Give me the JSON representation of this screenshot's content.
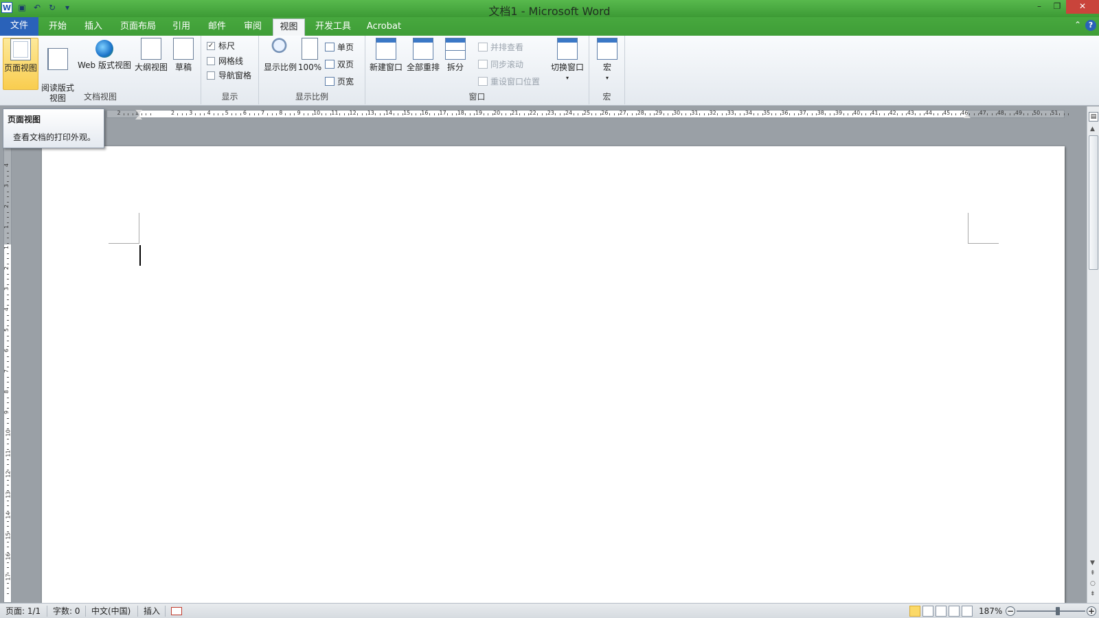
{
  "window": {
    "title": "文档1 - Microsoft Word",
    "controls": [
      "minimize-icon",
      "restore-icon",
      "close-icon"
    ]
  },
  "quick_access": [
    "word-logo-icon",
    "save-icon",
    "undo-icon",
    "redo-icon",
    "customize-icon"
  ],
  "tabs": [
    {
      "label": "文件",
      "active": false,
      "kind": "file"
    },
    {
      "label": "开始",
      "active": false
    },
    {
      "label": "插入",
      "active": false
    },
    {
      "label": "页面布局",
      "active": false
    },
    {
      "label": "引用",
      "active": false
    },
    {
      "label": "邮件",
      "active": false
    },
    {
      "label": "审阅",
      "active": false
    },
    {
      "label": "视图",
      "active": true
    },
    {
      "label": "开发工具",
      "active": false
    },
    {
      "label": "Acrobat",
      "active": false
    }
  ],
  "ribbon": {
    "doc_views": {
      "label": "文档视图",
      "buttons": [
        "页面视图",
        "阅读版式\n视图",
        "Web 版式视图",
        "大纲视图",
        "草稿"
      ],
      "selected": "页面视图"
    },
    "show": {
      "label": "显示",
      "checkboxes": [
        {
          "label": "标尺",
          "checked": true
        },
        {
          "label": "网格线",
          "checked": false
        },
        {
          "label": "导航窗格",
          "checked": false
        }
      ]
    },
    "zoom": {
      "label": "显示比例",
      "buttons": [
        "显示比例",
        "100%"
      ],
      "small": [
        "单页",
        "双页",
        "页宽"
      ]
    },
    "window": {
      "label": "窗口",
      "buttons": [
        "新建窗口",
        "全部重排",
        "拆分"
      ],
      "small_disabled": [
        "并排查看",
        "同步滚动",
        "重设窗口位置"
      ],
      "switch": "切换窗口"
    },
    "macros": {
      "label": "宏",
      "button": "宏"
    }
  },
  "tooltip": {
    "title": "页面视图",
    "description": "查看文档的打印外观。"
  },
  "ruler": {
    "h_numbers": [
      "2",
      "1",
      "1",
      "2",
      "3",
      "4",
      "5",
      "6",
      "7",
      "8",
      "9",
      "10",
      "11",
      "12",
      "13",
      "14",
      "15",
      "16",
      "17",
      "18",
      "19",
      "20",
      "21",
      "22",
      "23",
      "24",
      "25",
      "26",
      "27",
      "28",
      "29",
      "30",
      "31",
      "32",
      "33",
      "34",
      "35",
      "36",
      "37",
      "38",
      "39",
      "40",
      "41",
      "42",
      "43",
      "44",
      "45",
      "46",
      "47",
      "48",
      "49",
      "50",
      "51"
    ],
    "v_numbers": [
      "4",
      "3",
      "2",
      "1",
      "1",
      "2",
      "3",
      "4",
      "5",
      "6",
      "7",
      "8",
      "9",
      "10",
      "11",
      "12",
      "13",
      "14",
      "15",
      "16",
      "17"
    ]
  },
  "status": {
    "page": "页面: 1/1",
    "words": "字数: 0",
    "language": "中文(中国)",
    "mode": "插入",
    "zoom": "187%"
  },
  "colors": {
    "title_bar": "#4aaa40",
    "file_tab": "#2a62b9",
    "selected_button": "#f9cd4f",
    "close_button": "#c9443b"
  }
}
